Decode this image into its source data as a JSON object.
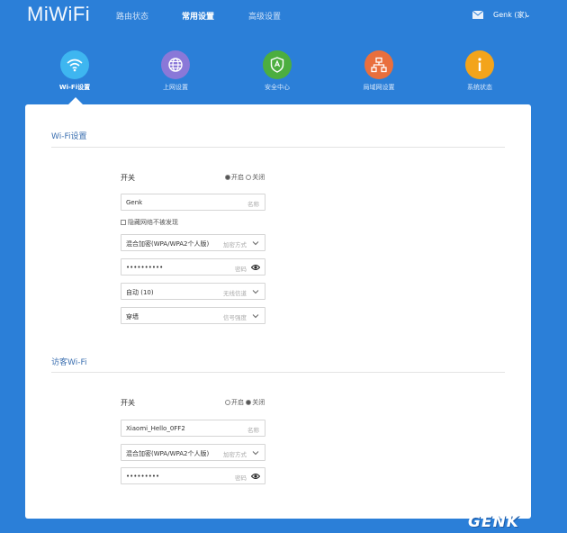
{
  "header": {
    "logo": "MiWiFi",
    "nav": [
      {
        "label": "路由状态",
        "active": false
      },
      {
        "label": "常用设置",
        "active": true
      },
      {
        "label": "高级设置",
        "active": false
      }
    ],
    "user_label": "Genk (家)",
    "mail_icon": "mail-icon",
    "caret_icon": "chevron-down-icon"
  },
  "categories": [
    {
      "label": "Wi-Fi设置",
      "icon": "wifi-icon",
      "color": "#3eb6f0",
      "active": true
    },
    {
      "label": "上网设置",
      "icon": "globe-icon",
      "color": "#8a78d8",
      "active": false
    },
    {
      "label": "安全中心",
      "icon": "shield-icon",
      "color": "#4cae3f",
      "active": false
    },
    {
      "label": "局域网设置",
      "icon": "network-icon",
      "color": "#e96f3d",
      "active": false
    },
    {
      "label": "系统状态",
      "icon": "info-icon",
      "color": "#f3a41b",
      "active": false
    }
  ],
  "wifi_section": {
    "title": "Wi-Fi设置",
    "switch_label": "开关",
    "radio_on": "开启",
    "radio_off": "关闭",
    "switch_state": "on",
    "name_value": "Genk",
    "name_hint": "名称",
    "hide_network_label": "隐藏网络不被发现",
    "encryption_value": "混合加密(WPA/WPA2个人版)",
    "encryption_hint": "加密方式",
    "password_value": "••••••••••",
    "password_hint": "密码",
    "channel_value": "自动 (10)",
    "channel_hint": "无线信道",
    "signal_value": "穿墙",
    "signal_hint": "信号强度"
  },
  "guest_section": {
    "title": "访客Wi-Fi",
    "switch_label": "开关",
    "radio_on": "开启",
    "radio_off": "关闭",
    "switch_state": "off",
    "name_value": "Xiaomi_Hello_0FF2",
    "name_hint": "名称",
    "encryption_value": "混合加密(WPA/WPA2个人版)",
    "encryption_hint": "加密方式",
    "password_value": "•••••••••",
    "password_hint": "密码"
  },
  "watermark": "GENK",
  "colors": {
    "background": "#2b7fd8",
    "card": "#ffffff",
    "section_title": "#3b6fb0"
  }
}
